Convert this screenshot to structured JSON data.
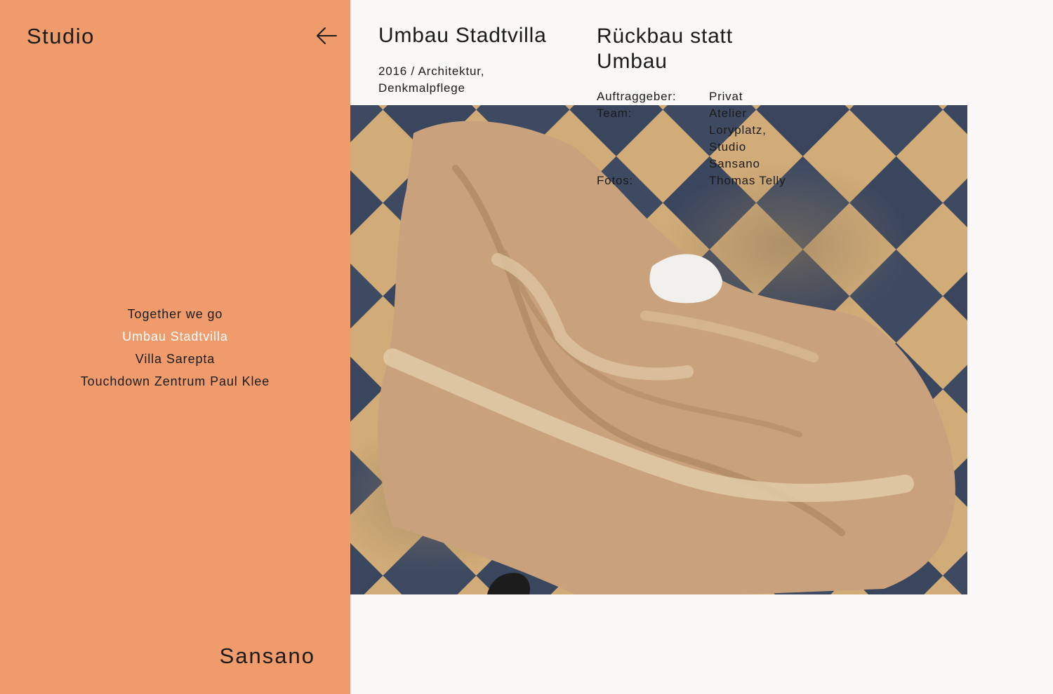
{
  "sidebar": {
    "brand_top": "Studio",
    "brand_bottom": "Sansano",
    "back_icon": "arrow-left-icon",
    "nav": [
      {
        "label": "Together we go",
        "active": false
      },
      {
        "label": "Umbau Stadtvilla",
        "active": true
      },
      {
        "label": "Villa Sarepta",
        "active": false
      },
      {
        "label": "Touchdown Zentrum Paul Klee",
        "active": false
      }
    ],
    "colors": {
      "background": "#ef9b6b",
      "active_text": "#ffffff"
    }
  },
  "project": {
    "title": "Umbau Stadtvilla",
    "meta_line1": "2016 / Architektur,",
    "meta_line2": "Denkmalpflege",
    "subtitle": "Rückbau statt Umbau",
    "credits": {
      "client_label": "Auftraggeber:",
      "client_value": "Privat",
      "team_label": "Team:",
      "team_values": [
        "Atelier",
        "Loryplatz,",
        "Studio",
        "Sansano"
      ],
      "photos_label": "Fotos:",
      "photos_value": "Thomas Telly"
    }
  }
}
